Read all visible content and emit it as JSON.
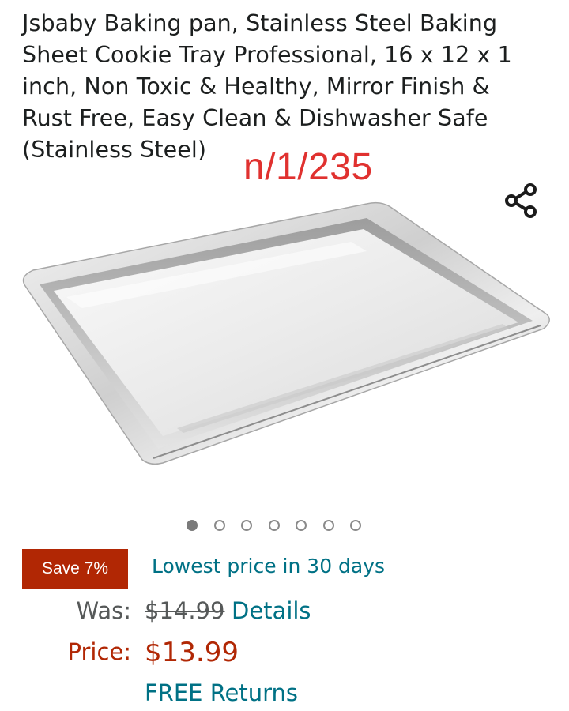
{
  "product": {
    "title": "Jsbaby Baking pan, Stainless Steel Baking Sheet Cookie Tray Professional, 16 x 12 x 1 inch, Non Toxic & Healthy, Mirror Finish & Rust Free, Easy Clean & Dishwasher Safe (Stainless Steel)",
    "annotation": "n/1/235"
  },
  "carousel": {
    "image_count": 7,
    "active_index": 0
  },
  "icons": {
    "share": "share-icon"
  },
  "pricing": {
    "save_badge": "Save 7%",
    "lowest_price": "Lowest price in 30 days",
    "was_label": "Was:",
    "was_value": "$14.99",
    "details_link": "Details",
    "price_label": "Price:",
    "price_value": "$13.99",
    "free_returns": "FREE Returns"
  },
  "colors": {
    "deal_red": "#b12704",
    "link_teal": "#007185",
    "annotation_red": "#e0312f"
  }
}
